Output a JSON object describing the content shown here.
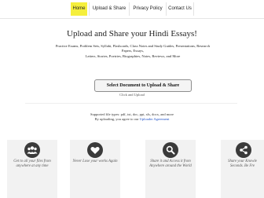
{
  "nav": {
    "items": [
      {
        "label": "Home",
        "active": true
      },
      {
        "label": "Upload & Share",
        "active": false
      },
      {
        "label": "Privacy Policy",
        "active": false
      },
      {
        "label": "Contact Us",
        "active": false
      }
    ],
    "active_color": "#f5ef3c"
  },
  "hero": {
    "title": "Upload and Share your Hindi Essays!",
    "desc_line1": "Practice Exams, Problem Sets, Syllabi, Flashcards, Class Notes and Study Guides, Presentations, Research Papers, Essays,",
    "desc_line2": "Letters, Stories, Poetries, Biographies, Notes, Reviews, and More"
  },
  "upload": {
    "button_label": "Select Document to Upload & Share",
    "sub_label": "Click and Upload"
  },
  "info": {
    "supported": "Supported file types: pdf, txt, doc, ppt, xls, docx, and more",
    "agreement_prefix": "By uploading, you agree to our",
    "agreement_link": "Uploader Agreement"
  },
  "features": [
    {
      "icon": "users-icon",
      "line1": "Get to all your files from",
      "line2": "anywhere at any time"
    },
    {
      "icon": "heart-icon",
      "line1": "Never Lose your works Again",
      "line2": ""
    },
    {
      "icon": "search-icon",
      "line1": "Share it and Access it from",
      "line2": "Anywhere around the World"
    },
    {
      "icon": "share-icon",
      "line1": "Share your Knowle",
      "line2": "Seconds. Be Fre"
    }
  ]
}
